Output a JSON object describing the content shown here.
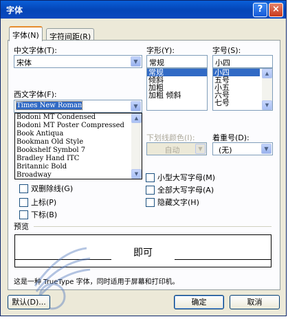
{
  "window": {
    "title": "字体",
    "help_glyph": "?",
    "close_glyph": "×"
  },
  "tabs": [
    {
      "label": "字体(N)",
      "active": true
    },
    {
      "label": "字符间距(R)",
      "active": false
    }
  ],
  "chinese_font": {
    "label": "中文字体(T):",
    "value": "宋体"
  },
  "font_style": {
    "label": "字形(Y):",
    "value": "常规",
    "options": [
      "常规",
      "倾斜",
      "加粗",
      "加粗 倾斜"
    ],
    "selected_index": 0
  },
  "font_size": {
    "label": "字号(S):",
    "value": "小四",
    "options": [
      "小四",
      "五号",
      "小五",
      "六号",
      "七号"
    ],
    "selected_index": 0
  },
  "western_font": {
    "label": "西文字体(F):",
    "value": "Times New Roman",
    "options": [
      "Bodoni MT Condensed",
      "Bodoni MT Poster Compressed",
      "Book Antiqua",
      "Bookman Old Style",
      "Bookshelf Symbol 7",
      "Bradley Hand ITC",
      "Britannic Bold",
      "Broadway"
    ]
  },
  "underline_color": {
    "label": "下划线颜色(I):",
    "value": "自动"
  },
  "emphasis": {
    "label": "着重号(D):",
    "value": "(无)"
  },
  "effects": {
    "left": [
      {
        "label": "双删除线(G)"
      },
      {
        "label": "上标(P)"
      },
      {
        "label": "下标(B)"
      }
    ],
    "right": [
      {
        "label": "小型大写字母(M)"
      },
      {
        "label": "全部大写字母(A)"
      },
      {
        "label": "隐藏文字(H)"
      }
    ]
  },
  "preview": {
    "label": "预览",
    "sample": "即可",
    "description": "这是一种 TrueType 字体，同时适用于屏幕和打印机。"
  },
  "buttons": {
    "default": "默认(D)...",
    "ok": "确定",
    "cancel": "取消"
  },
  "colors": {
    "titlebar": "#0a5fd8",
    "selection": "#316ac5",
    "dialog_bg": "#ece9d8"
  }
}
